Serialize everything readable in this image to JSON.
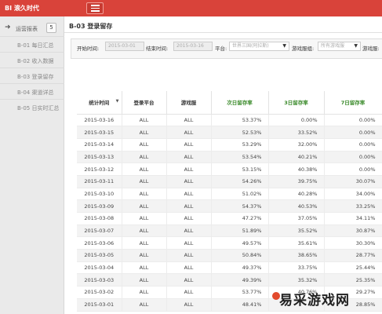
{
  "app": {
    "brand": "BI 滚久时代"
  },
  "sidebar": {
    "header_label": "运营报表",
    "header_count": "5",
    "items": [
      {
        "label": "B-01 每日汇总"
      },
      {
        "label": "B-02 收入数据"
      },
      {
        "label": "B-03 登录留存"
      },
      {
        "label": "B-04 渠道详总"
      },
      {
        "label": "B-05 日实时汇总"
      }
    ]
  },
  "page": {
    "title": "B-03 登录留存"
  },
  "filters": {
    "start_label": "开始时间:",
    "start_value": "2015-03-01",
    "end_label": "结束时间:",
    "end_value": "2015-03-16",
    "platform_label": "平台:",
    "platform_value": "世界三国(阿拉斯)",
    "server_label": "游戏服组:",
    "server_value": "所有游戏服",
    "server2_label": "游戏服:"
  },
  "table": {
    "columns": [
      "统计时间",
      "登录平台",
      "游戏服",
      "次日留存率",
      "3日留存率",
      "7日留存率"
    ],
    "rows": [
      [
        "2015-03-16",
        "ALL",
        "ALL",
        "53.37%",
        "0.00%",
        "0.00%"
      ],
      [
        "2015-03-15",
        "ALL",
        "ALL",
        "52.53%",
        "33.52%",
        "0.00%"
      ],
      [
        "2015-03-14",
        "ALL",
        "ALL",
        "53.29%",
        "32.00%",
        "0.00%"
      ],
      [
        "2015-03-13",
        "ALL",
        "ALL",
        "53.54%",
        "40.21%",
        "0.00%"
      ],
      [
        "2015-03-12",
        "ALL",
        "ALL",
        "53.15%",
        "40.38%",
        "0.00%"
      ],
      [
        "2015-03-11",
        "ALL",
        "ALL",
        "54.26%",
        "39.75%",
        "30.07%"
      ],
      [
        "2015-03-10",
        "ALL",
        "ALL",
        "51.02%",
        "40.28%",
        "34.00%"
      ],
      [
        "2015-03-09",
        "ALL",
        "ALL",
        "54.37%",
        "40.53%",
        "33.25%"
      ],
      [
        "2015-03-08",
        "ALL",
        "ALL",
        "47.27%",
        "37.05%",
        "34.11%"
      ],
      [
        "2015-03-07",
        "ALL",
        "ALL",
        "51.89%",
        "35.52%",
        "30.87%"
      ],
      [
        "2015-03-06",
        "ALL",
        "ALL",
        "49.57%",
        "35.61%",
        "30.30%"
      ],
      [
        "2015-03-05",
        "ALL",
        "ALL",
        "50.84%",
        "38.65%",
        "28.77%"
      ],
      [
        "2015-03-04",
        "ALL",
        "ALL",
        "49.37%",
        "33.75%",
        "25.44%"
      ],
      [
        "2015-03-03",
        "ALL",
        "ALL",
        "49.39%",
        "35.32%",
        "25.35%"
      ],
      [
        "2015-03-02",
        "ALL",
        "ALL",
        "53.77%",
        "40.76%",
        "29.27%"
      ],
      [
        "2015-03-01",
        "ALL",
        "ALL",
        "48.41%",
        "",
        "28.85%"
      ]
    ]
  },
  "watermark": {
    "text": "易采游戏网"
  },
  "colors": {
    "topbar": "#d9433a",
    "accent_green": "#3a8a2a",
    "sidebar_bg": "#eaeaea"
  },
  "icons": {
    "menu": "hamburger-icon",
    "sidebar_header": "arrow-right-icon",
    "sort": "sort-caret-icon",
    "dropdown": "caret-down-icon"
  }
}
